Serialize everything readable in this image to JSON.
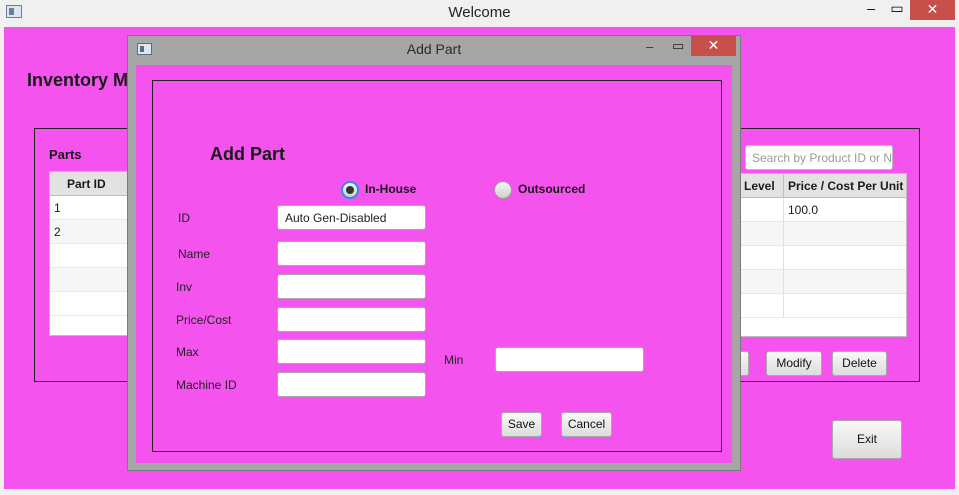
{
  "main_window": {
    "title": "Welcome",
    "controls": {
      "minimize": "–",
      "maximize": "▭",
      "close": "✕"
    },
    "heading": "Inventory M",
    "parts": {
      "label": "Parts",
      "column": "Part ID",
      "rows": [
        "1",
        "2",
        "",
        "",
        ""
      ]
    },
    "products": {
      "search_placeholder": "Search by Product ID or N",
      "columns": [
        "Level",
        "Price / Cost Per Unit"
      ],
      "rows": [
        "100.0",
        "",
        "",
        "",
        ""
      ],
      "buttons": {
        "modify": "Modify",
        "delete": "Delete"
      }
    },
    "exit_label": "Exit",
    "background_color": "#f453ee"
  },
  "dialog": {
    "title": "Add Part",
    "controls": {
      "minimize": "–",
      "maximize": "▭",
      "close": "✕"
    },
    "heading": "Add Part",
    "radios": {
      "in_house": "In-House",
      "outsourced": "Outsourced",
      "selected": "in_house"
    },
    "fields": {
      "id_label": "ID",
      "id_value": "Auto Gen-Disabled",
      "name_label": "Name",
      "inv_label": "Inv",
      "price_label": "Price/Cost",
      "max_label": "Max",
      "min_label": "Min",
      "machine_label": "Machine ID"
    },
    "buttons": {
      "save": "Save",
      "cancel": "Cancel"
    },
    "frame_color": "#a6a6a6"
  }
}
